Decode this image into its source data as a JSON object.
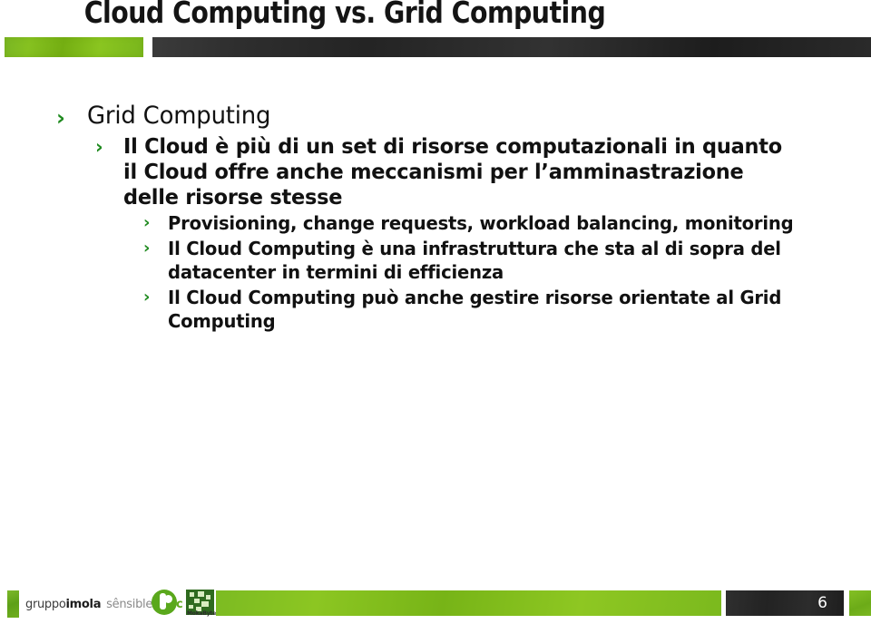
{
  "slide": {
    "title": "Cloud Computing vs. Grid Computing",
    "page_number": "6",
    "accent_green": "#7cb82a",
    "bar_dark": "#2a2a2a",
    "bullet_glyph": "›",
    "bullet_color": "#1f8a1f"
  },
  "content": {
    "level1": {
      "text": "Grid Computing"
    },
    "level2": {
      "text": "Il Cloud è più di un set di risorse computazionali in quanto il Cloud offre anche meccanismi per l’amminastrazione delle risorse stesse"
    },
    "level3": [
      {
        "text": "Provisioning, change requests, workload balancing, monitoring"
      },
      {
        "text": "Il Cloud Computing è una infrastruttura che sta al di sopra del datacenter in termini di efficienza"
      },
      {
        "text": "Il Cloud Computing può anche gestire risorse orientate al Grid Computing"
      }
    ]
  },
  "footer": {
    "logo_gruppo": "gruppo",
    "logo_imola": "imola",
    "logo_sensible": "sênsible",
    "logo_logic": "logic",
    "logo_moka_label": "MokaByte"
  }
}
